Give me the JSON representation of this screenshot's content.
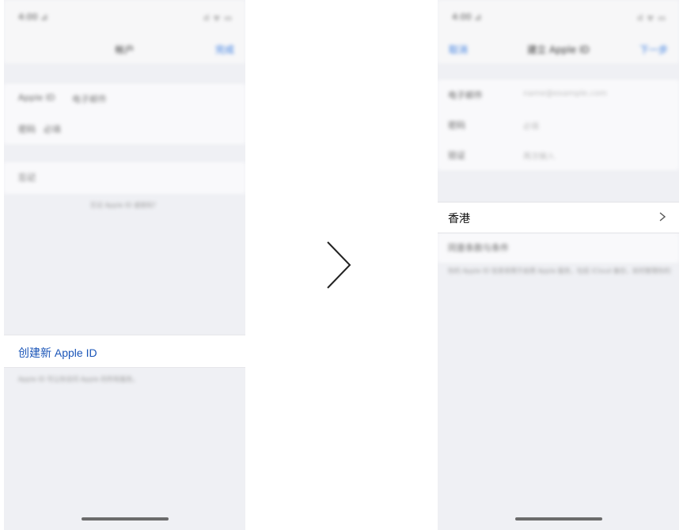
{
  "left_phone": {
    "status": {
      "time": "4:00 ⊿",
      "indicators": "ıl ᯤ ▭"
    },
    "nav": {
      "title": "帐户",
      "right": "完成"
    },
    "rows": [
      {
        "label": "Apple ID",
        "value": "电子邮件"
      },
      {
        "label": "密码",
        "value": "必填"
      }
    ],
    "forgot_row": {
      "label": "忘记"
    },
    "forgot_link": "忘记 Apple ID 或密码？",
    "create_label": "创建新 Apple ID",
    "footnote": "Apple ID 可让你访问 Apple 的所有服务。"
  },
  "right_phone": {
    "status": {
      "time": "4:00 ⊿",
      "indicators": "ıl ᯤ ▭"
    },
    "nav": {
      "back": "取消",
      "title": "建立 Apple ID",
      "next": "下一步"
    },
    "rows": [
      {
        "label": "电子邮件",
        "placeholder": "name@example.com"
      },
      {
        "label": "密码",
        "placeholder": "必填"
      },
      {
        "label": "验证",
        "placeholder": "再次输入"
      }
    ],
    "region": "香港",
    "terms_row": "同意条款与条件",
    "terms_note": "你的 Apple ID 信息将用于启用 Apple 服务，包括 iCloud 备份，如何管理你的数据。"
  },
  "colors": {
    "link": "#1a55b8",
    "background": "#eff0f4",
    "accent": "#3b7de0"
  },
  "icons": [
    "chevron-right-icon",
    "big-arrow-right-icon"
  ]
}
